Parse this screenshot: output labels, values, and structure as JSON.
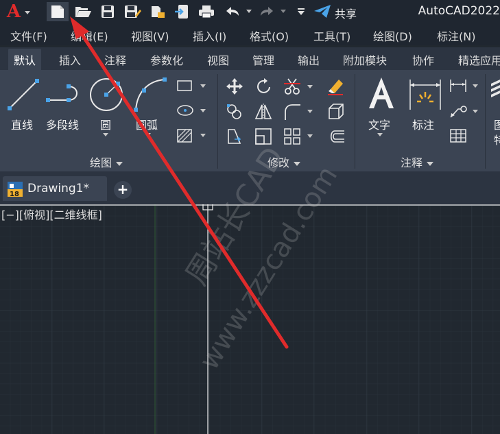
{
  "title_bar": {
    "app_title": "AutoCAD2022",
    "share_label": "共享",
    "icons": [
      "autocad-logo-icon",
      "new-file-icon",
      "open-file-icon",
      "save-icon",
      "save-as-icon",
      "open-web-icon",
      "export-icon",
      "print-icon",
      "undo-icon",
      "redo-icon",
      "customize-dropdown-icon",
      "share-icon"
    ]
  },
  "menu_bar": {
    "items": [
      "文件(F)",
      "编辑(E)",
      "视图(V)",
      "插入(I)",
      "格式(O)",
      "工具(T)",
      "绘图(D)",
      "标注(N)"
    ]
  },
  "ribbon_tabs": {
    "items": [
      "默认",
      "插入",
      "注释",
      "参数化",
      "视图",
      "管理",
      "输出",
      "附加模块",
      "协作",
      "精选应用"
    ],
    "active": "默认"
  },
  "ribbon": {
    "draw_panel": {
      "title": "绘图",
      "line_label": "直线",
      "polyline_label": "多段线",
      "circle_label": "圆",
      "arc_label": "圆弧"
    },
    "modify_panel": {
      "title": "修改"
    },
    "annotation_panel": {
      "title": "注释",
      "text_label": "文字",
      "dimension_label": "标注"
    },
    "layers_panel_partial": {
      "label_top": "图",
      "label_bottom": "特"
    }
  },
  "document_tabs": {
    "tab_label": "Drawing1*",
    "new_tab_symbol": "+"
  },
  "canvas": {
    "viewport_label": "[−][俯视][二维线框]",
    "watermark_cn": "周站长CAD",
    "watermark_url": "www.zzzcad.com"
  },
  "colors": {
    "accent_red": "#e02b2b",
    "share_blue": "#4aa3e8",
    "background": "#212830"
  }
}
